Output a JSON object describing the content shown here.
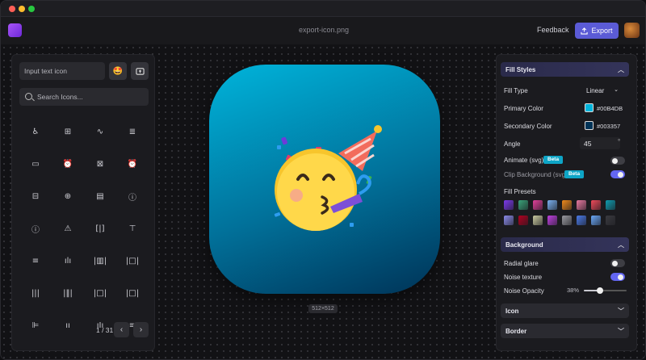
{
  "window": {
    "filename": "export-icon.png"
  },
  "header": {
    "feedback_label": "Feedback",
    "export_label": "Export"
  },
  "left": {
    "text_placeholder": "Input text icon",
    "search_placeholder": "Search Icons...",
    "icons": [
      "accessibility-icon",
      "square-plus-icon",
      "activity-icon",
      "adjustment-icon",
      "airplay-icon",
      "alarm-clock-icon",
      "alarm-off-icon",
      "alarm-clock-check-icon",
      "alarm-minus-icon",
      "alarm-plus-icon",
      "album-icon",
      "alert-circle-icon",
      "alert-octagon-icon",
      "alert-triangle-icon",
      "align-center-vertical-icon",
      "align-end-vertical-icon",
      "align-justify-icon",
      "align-end-horizontal-icon",
      "align-horizontal-distribute-icon",
      "align-horizontal-space-icon",
      "align-start-vertical-icon",
      "align-vertical-center-icon",
      "align-horizontal-space-around-icon",
      "align-horizontal-distribute-end-icon",
      "align-top-icon",
      "align-bottom-icon",
      "align-center-icon",
      "align-left-icon"
    ],
    "glyphs": [
      "♿",
      "⊞",
      "∿",
      "≣",
      "▭",
      "⏰",
      "⊠",
      "⏰",
      "⊟",
      "⊕",
      "▤",
      "ⓘ",
      "ⓘ",
      "⚠",
      "[|]",
      "⊤",
      "≡",
      "ılı",
      "|▥|",
      "|□|",
      "|||",
      "|‖|",
      "|□|",
      "|□|",
      "⊫",
      "ıı",
      "ıIı",
      "≡"
    ],
    "pager": "1 / 31"
  },
  "preview": {
    "size_label": "512×512",
    "emoji": "🥳",
    "primary_color": "#00B4DB",
    "secondary_color": "#003357"
  },
  "right": {
    "fill_styles_title": "Fill Styles",
    "fill_type_label": "Fill Type",
    "fill_type_value": "Linear",
    "primary_label": "Primary Color",
    "primary_hex": "#00B4DB",
    "secondary_label": "Secondary Color",
    "secondary_hex": "#003357",
    "angle_label": "Angle",
    "angle_value": "45",
    "angle_unit": "°",
    "animate_label": "Animate (svg)",
    "clip_label": "Clip Background (svg)",
    "beta_label": "Beta",
    "animate_on": false,
    "clip_on": true,
    "presets_label": "Fill Presets",
    "presets_row1": [
      "#7c3aed",
      "#3aa37a",
      "#e0409a",
      "#7ab0f0",
      "#f08a1c",
      "#e879a0",
      "#f04a5a",
      "#0f9cb0"
    ],
    "presets_row2": [
      "#8a8ae8",
      "#b00020",
      "#c8c8a0",
      "#c040e0",
      "#9a9aa0",
      "#4a7ae8",
      "#6aa8f8",
      "#3a3a40"
    ],
    "background_title": "Background",
    "radial_label": "Radial glare",
    "radial_on": false,
    "noise_label": "Noise texture",
    "noise_on": true,
    "noise_opacity_label": "Noise Opacity",
    "noise_opacity_value": "38%",
    "noise_opacity_fraction": 0.38,
    "icon_title": "Icon",
    "border_title": "Border"
  }
}
